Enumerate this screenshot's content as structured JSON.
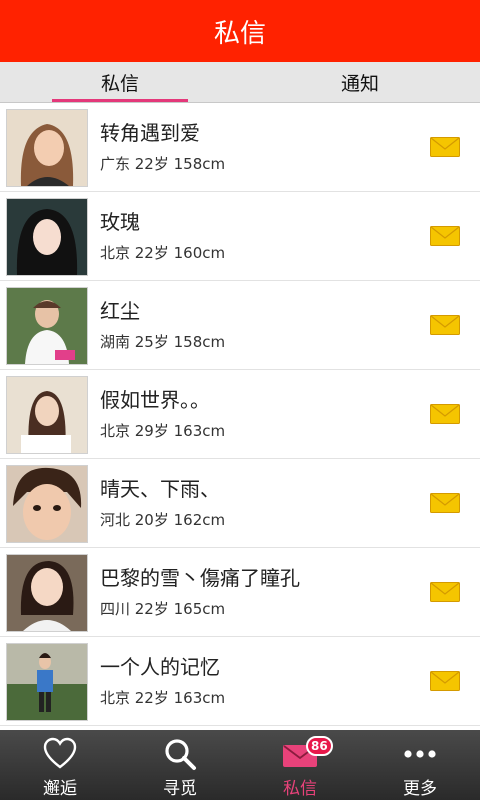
{
  "header": {
    "title": "私信"
  },
  "tabs": [
    {
      "label": "私信",
      "active": true
    },
    {
      "label": "通知",
      "active": false
    }
  ],
  "messages": [
    {
      "name": "转角遇到爱",
      "info": "广东 22岁 158cm"
    },
    {
      "name": "玫瑰",
      "info": "北京 22岁 160cm"
    },
    {
      "name": "红尘",
      "info": "湖南 25岁 158cm"
    },
    {
      "name": "假如世界。。",
      "info": "北京 29岁 163cm"
    },
    {
      "name": "晴天、下雨、",
      "info": "河北 20岁 162cm"
    },
    {
      "name": "巴黎的雪丶傷痛了瞳孔",
      "info": "四川 22岁 165cm"
    },
    {
      "name": "一个人的记忆",
      "info": "北京 22岁 163cm"
    }
  ],
  "bottom_nav": [
    {
      "label": "邂逅",
      "icon": "heart-icon"
    },
    {
      "label": "寻觅",
      "icon": "search-icon"
    },
    {
      "label": "私信",
      "icon": "mail-icon",
      "badge": "86",
      "active": true
    },
    {
      "label": "更多",
      "icon": "more-icon"
    }
  ],
  "colors": {
    "header": "#ff2200",
    "accent": "#e4387a",
    "envelope": "#f5c500",
    "navbar": "#333333"
  }
}
